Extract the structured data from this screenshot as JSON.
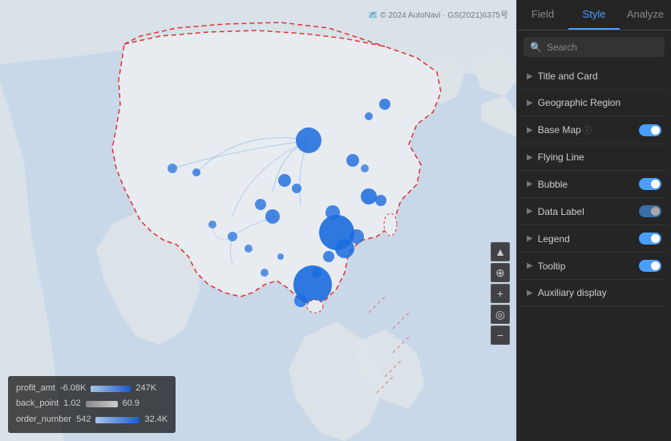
{
  "tabs": [
    {
      "label": "Field",
      "active": false
    },
    {
      "label": "Style",
      "active": true
    },
    {
      "label": "Analyze",
      "active": false
    }
  ],
  "search": {
    "placeholder": "Search",
    "value": ""
  },
  "style_items": [
    {
      "id": "title-card",
      "label": "Title and Card",
      "has_toggle": false
    },
    {
      "id": "geographic-region",
      "label": "Geographic Region",
      "has_toggle": false
    },
    {
      "id": "base-map",
      "label": "Base Map",
      "has_toggle": true,
      "toggle_state": "on",
      "has_info": true
    },
    {
      "id": "flying-line",
      "label": "Flying Line",
      "has_toggle": false
    },
    {
      "id": "bubble",
      "label": "Bubble",
      "has_toggle": true,
      "toggle_state": "on"
    },
    {
      "id": "data-label",
      "label": "Data Label",
      "has_toggle": true,
      "toggle_state": "partial"
    },
    {
      "id": "legend",
      "label": "Legend",
      "has_toggle": true,
      "toggle_state": "on"
    },
    {
      "id": "tooltip",
      "label": "Tooltip",
      "has_toggle": true,
      "toggle_state": "on"
    },
    {
      "id": "auxiliary-display",
      "label": "Auxiliary display",
      "has_toggle": false
    }
  ],
  "legend": {
    "profit_amt": {
      "label": "profit_amt",
      "min": "-6.08K",
      "max": "247K"
    },
    "back_point": {
      "label": "back_point",
      "min": "1.02",
      "max": "60.9"
    },
    "order_number": {
      "label": "order_number",
      "min": "542",
      "max": "32.4K"
    }
  },
  "watermark": "© 2024 AutoNavi · GS(2021)6375号",
  "map_controls": [
    {
      "id": "navigate",
      "icon": "▲"
    },
    {
      "id": "compass",
      "icon": "⊕"
    },
    {
      "id": "zoom-in",
      "icon": "+"
    },
    {
      "id": "locate",
      "icon": "◎"
    },
    {
      "id": "zoom-out",
      "icon": "−"
    }
  ]
}
